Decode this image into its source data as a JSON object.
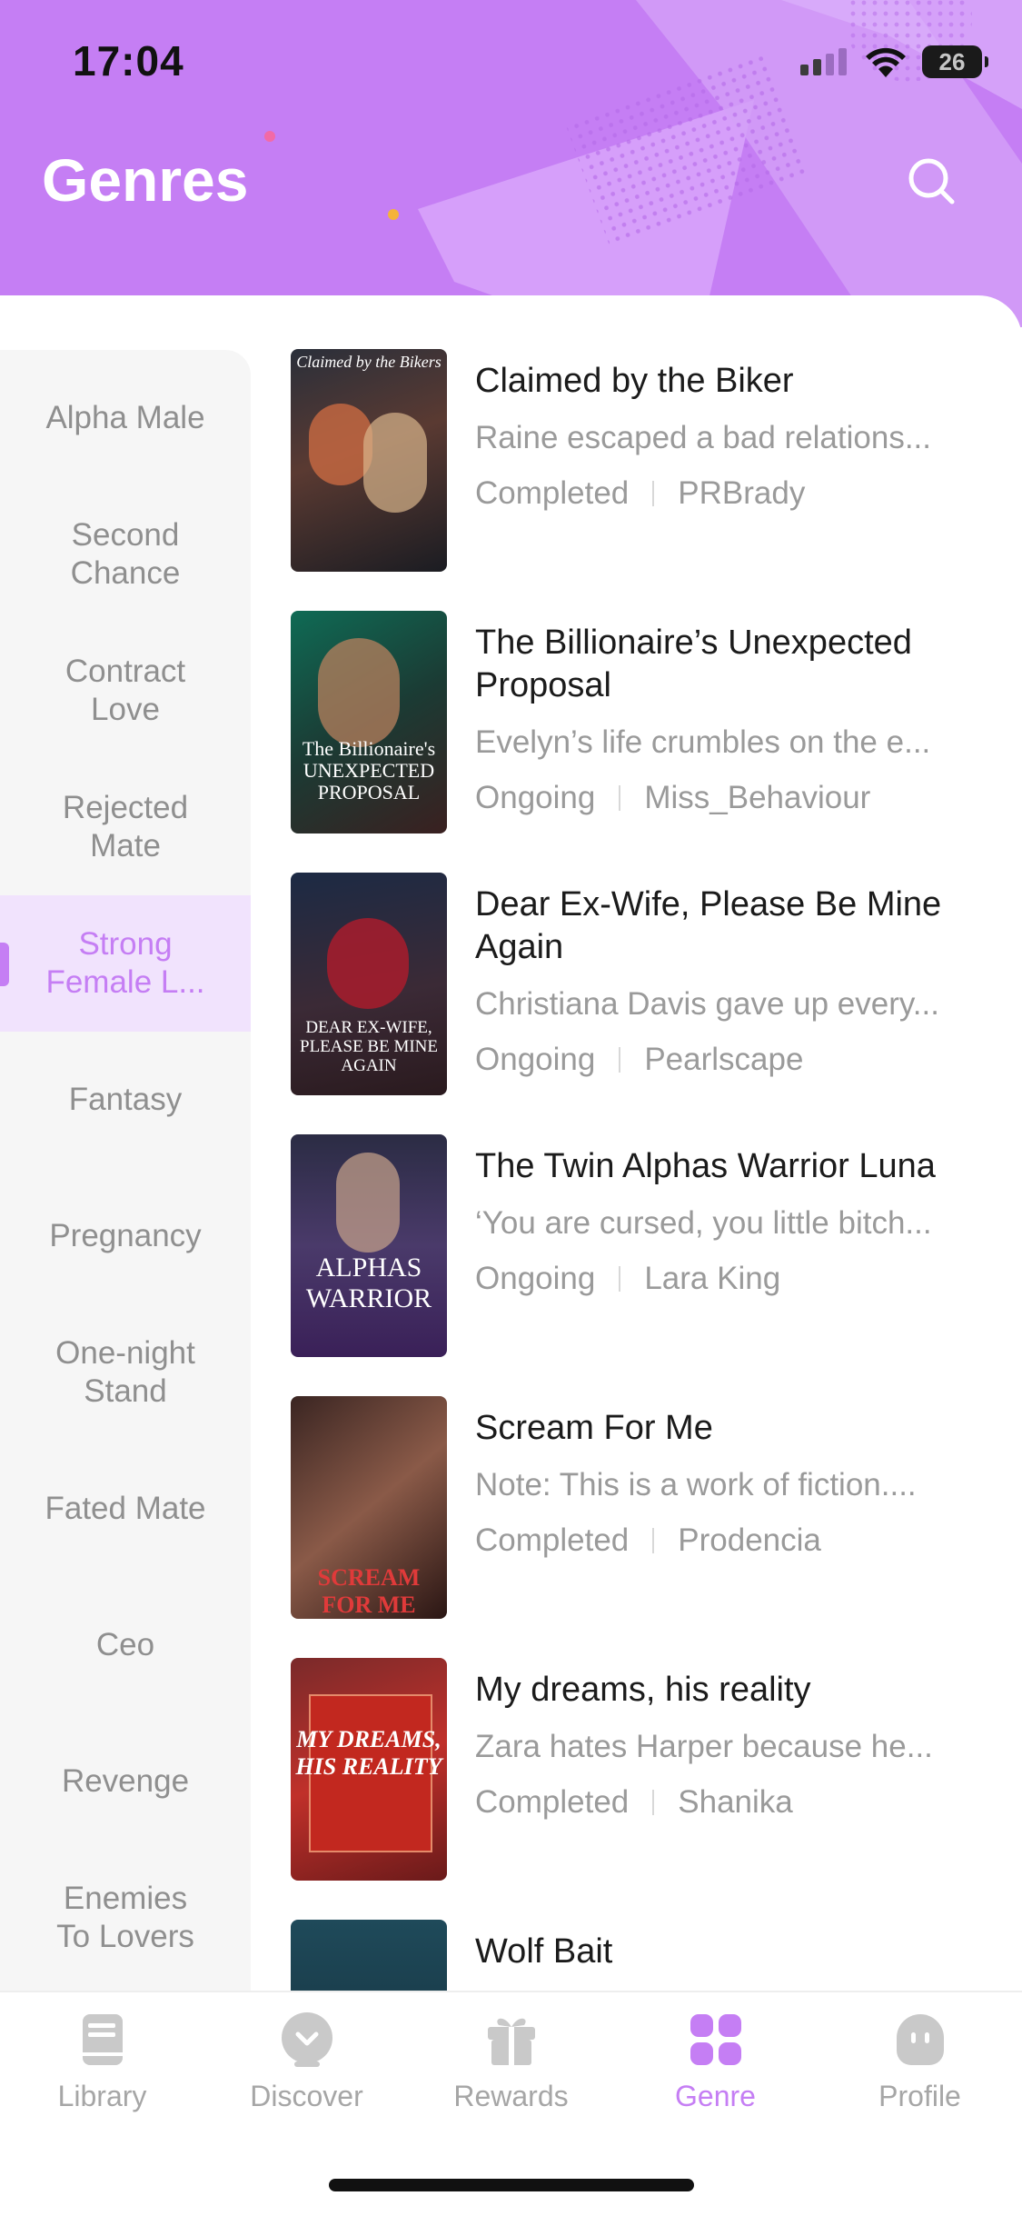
{
  "status_bar": {
    "time": "17:04",
    "battery": "26"
  },
  "header": {
    "title": "Genres"
  },
  "colors": {
    "accent": "#c57ef4",
    "header_bg": "#c57ef4",
    "active_row_bg": "#f1e3fd"
  },
  "genres": [
    {
      "label": "Alpha Male"
    },
    {
      "label": "Second Chance"
    },
    {
      "label": "Contract Love"
    },
    {
      "label": "Rejected Mate"
    },
    {
      "label": "Strong Female L...",
      "active": true
    },
    {
      "label": "Fantasy"
    },
    {
      "label": "Pregnancy"
    },
    {
      "label": "One-night Stand"
    },
    {
      "label": "Fated Mate"
    },
    {
      "label": "Ceo"
    },
    {
      "label": "Revenge"
    },
    {
      "label": "Enemies To Lovers"
    }
  ],
  "books": [
    {
      "title": "Claimed by the Biker",
      "description": "Raine escaped a bad relations...",
      "status": "Completed",
      "author": "PRBrady",
      "cover_text": "Claimed by the Bikers"
    },
    {
      "title": "The Billionaire’s Unexpected Proposal",
      "description": "Evelyn’s life crumbles on the e...",
      "status": "Ongoing",
      "author": "Miss_Behaviour",
      "cover_text": "The Billionaire's UNEXPECTED PROPOSAL"
    },
    {
      "title": "Dear Ex-Wife, Please Be Mine Again",
      "description": "Christiana Davis gave up every...",
      "status": "Ongoing",
      "author": "Pearlscape",
      "cover_text": "DEAR EX-WIFE, PLEASE BE MINE AGAIN"
    },
    {
      "title": "The Twin Alphas Warrior Luna",
      "description": "‘You are cursed, you little bitch...",
      "status": "Ongoing",
      "author": "Lara King",
      "cover_text": "ALPHAS WARRIOR"
    },
    {
      "title": "Scream For Me",
      "description": "Note: This is a work of fiction....",
      "status": "Completed",
      "author": "Prodencia",
      "cover_text": "SCREAM FOR ME"
    },
    {
      "title": "My dreams, his reality",
      "description": "Zara hates Harper because he...",
      "status": "Completed",
      "author": "Shanika",
      "cover_text": "MY DREAMS, HIS REALITY"
    },
    {
      "title": "Wolf Bait"
    }
  ],
  "tabs": [
    {
      "label": "Library",
      "icon": "book-icon"
    },
    {
      "label": "Discover",
      "icon": "compass-icon"
    },
    {
      "label": "Rewards",
      "icon": "gift-icon"
    },
    {
      "label": "Genre",
      "icon": "grid-icon",
      "active": true
    },
    {
      "label": "Profile",
      "icon": "face-icon"
    }
  ]
}
